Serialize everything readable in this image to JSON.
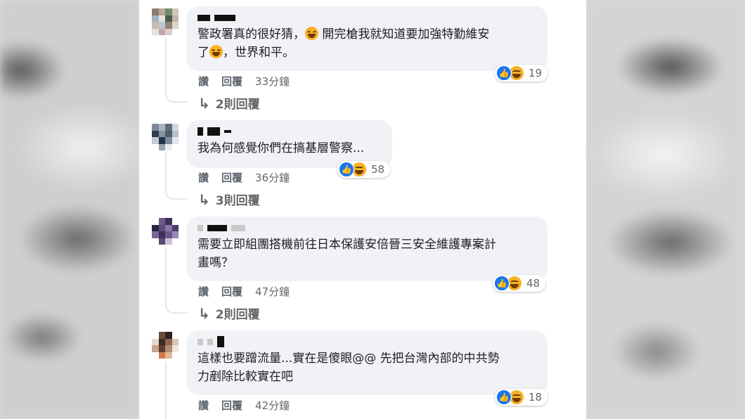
{
  "comments": [
    {
      "text_a": "警政署真的很好猜，",
      "text_b": " 開完槍我就知道要加強特勤維安",
      "text_c": "了",
      "text_d": "，世界和平。",
      "reactions": "19",
      "like": "讚",
      "reply": "回覆",
      "time": "33分鐘",
      "replies_label": "2則回覆"
    },
    {
      "text": "我為何感覺你們在搞基層警察...",
      "reactions": "58",
      "like": "讚",
      "reply": "回覆",
      "time": "36分鐘",
      "replies_label": "3則回覆"
    },
    {
      "text": "需要立即組團搭機前往日本保護安倍晉三安全維護專案計\n畫嗎？",
      "reactions": "48",
      "like": "讚",
      "reply": "回覆",
      "time": "47分鐘",
      "replies_label": "2則回覆"
    },
    {
      "text": "這樣也要蹭流量...實在是傻眼@@ 先把台灣內部的中共勢\n力剷除比較實在吧",
      "reactions": "18",
      "like": "讚",
      "reply": "回覆",
      "time": "42分鐘"
    }
  ],
  "icons": {
    "reply_arrow": "↳",
    "like": "👍"
  },
  "colors": {
    "bubble": "#f0f2f5",
    "like_blue": "#1877f2",
    "haha_yellow": "#f7b125",
    "meta_gray": "#65676b"
  }
}
